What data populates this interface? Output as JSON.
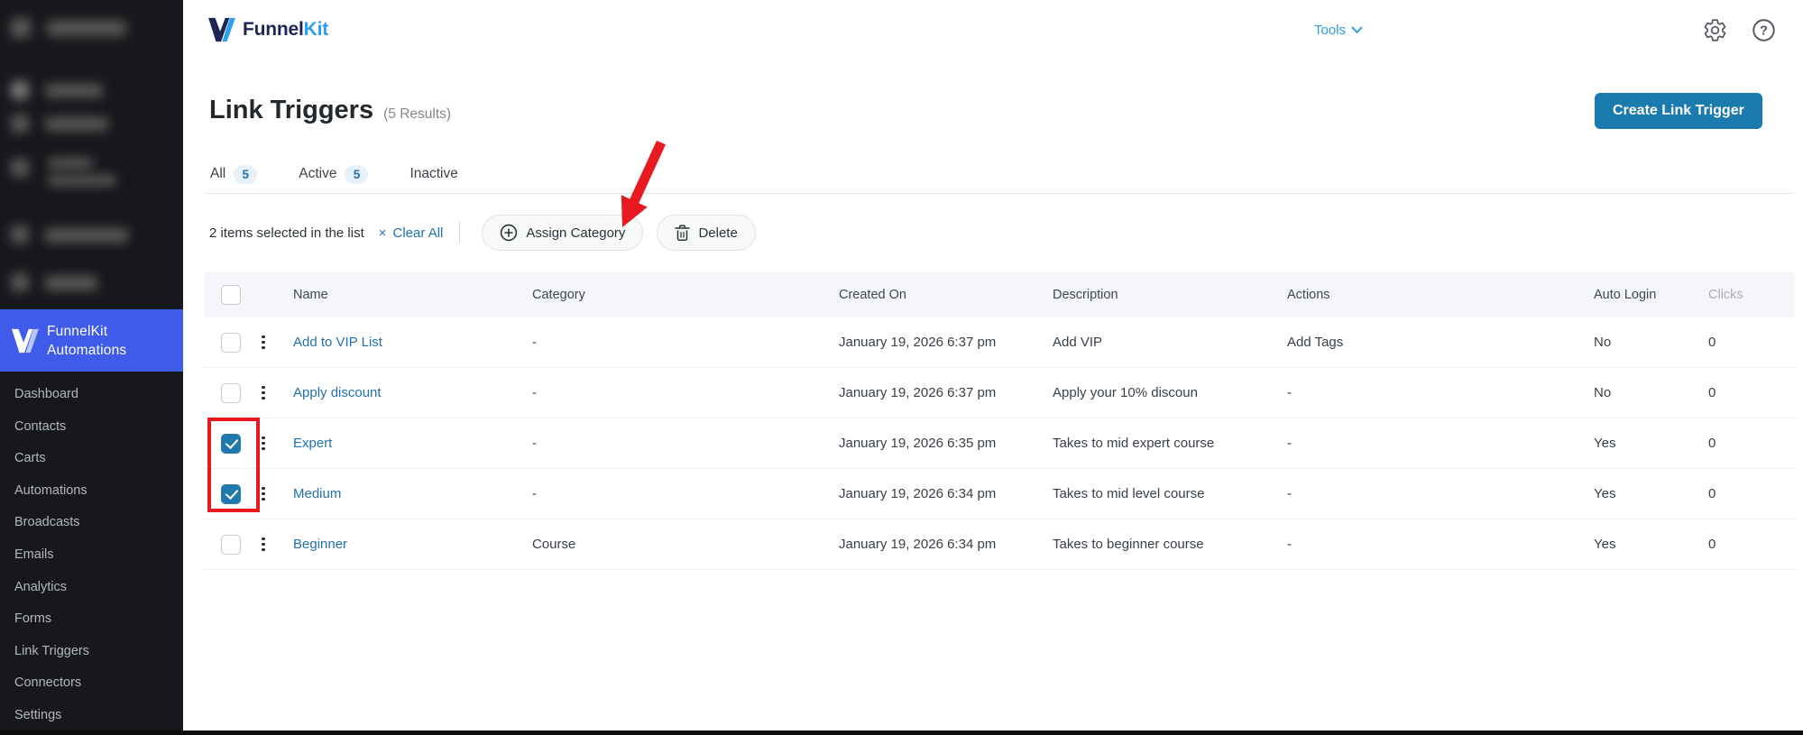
{
  "topnav": {
    "logo": {
      "part1": "Funnel",
      "part2": "Kit"
    },
    "items": [
      "Dashboard",
      "Contacts",
      "Carts",
      "Automations",
      "Broadcasts",
      "Emails",
      "Analytics"
    ],
    "tools_label": "Tools",
    "icons": {
      "settings": "gear-icon",
      "help": "question-circle-icon",
      "tools_chevron": "chevron-down-icon"
    }
  },
  "sidebar": {
    "brand": {
      "line1": "FunnelKit",
      "line2": "Automations"
    },
    "items": [
      {
        "label": "Dashboard"
      },
      {
        "label": "Contacts"
      },
      {
        "label": "Carts"
      },
      {
        "label": "Automations"
      },
      {
        "label": "Broadcasts"
      },
      {
        "label": "Emails"
      },
      {
        "label": "Analytics"
      },
      {
        "label": "Forms"
      },
      {
        "label": "Link Triggers",
        "active": true
      },
      {
        "label": "Connectors"
      },
      {
        "label": "Settings"
      }
    ]
  },
  "page": {
    "title": "Link Triggers",
    "results": "(5 Results)",
    "create_button": "Create Link Trigger"
  },
  "tabs": [
    {
      "label": "All",
      "count": "5",
      "active": true
    },
    {
      "label": "Active",
      "count": "5"
    },
    {
      "label": "Inactive"
    }
  ],
  "toolbar": {
    "selection_text": "2 items selected in the list",
    "clear_icon": "×",
    "clear_label": "Clear All",
    "assign_category_label": "Assign Category",
    "delete_label": "Delete"
  },
  "table": {
    "columns": [
      "Name",
      "Category",
      "Created On",
      "Description",
      "Actions",
      "Auto Login",
      "Clicks"
    ],
    "rows": [
      {
        "name": "Add to VIP List",
        "category": "-",
        "created": "January 19, 2026 6:37 pm",
        "description": "Add VIP",
        "actions": "Add Tags",
        "auto_login": "No",
        "clicks": "0",
        "checked": false
      },
      {
        "name": "Apply discount",
        "category": "-",
        "created": "January 19, 2026 6:37 pm",
        "description": "Apply your 10% discoun",
        "actions": "-",
        "auto_login": "No",
        "clicks": "0",
        "checked": false
      },
      {
        "name": "Expert",
        "category": "-",
        "created": "January 19, 2026 6:35 pm",
        "description": "Takes to mid expert course",
        "actions": "-",
        "auto_login": "Yes",
        "clicks": "0",
        "checked": true
      },
      {
        "name": "Medium",
        "category": "-",
        "created": "January 19, 2026 6:34 pm",
        "description": "Takes to mid level course",
        "actions": "-",
        "auto_login": "Yes",
        "clicks": "0",
        "checked": true
      },
      {
        "name": "Beginner",
        "category": "Course",
        "created": "January 19, 2026 6:34 pm",
        "description": "Takes to beginner course",
        "actions": "-",
        "auto_login": "Yes",
        "clicks": "0",
        "checked": false
      }
    ]
  },
  "colors": {
    "accent": "#2271b1",
    "primary_button": "#1b7bae",
    "brand_blue": "#3e5be9",
    "topnav_tools": "#2e9ce1",
    "annotation_red": "#e81a1f",
    "sidebar_bg": "#17181b",
    "header_row_bg": "#f5f6f9",
    "checked_checkbox": "#2179b0"
  }
}
